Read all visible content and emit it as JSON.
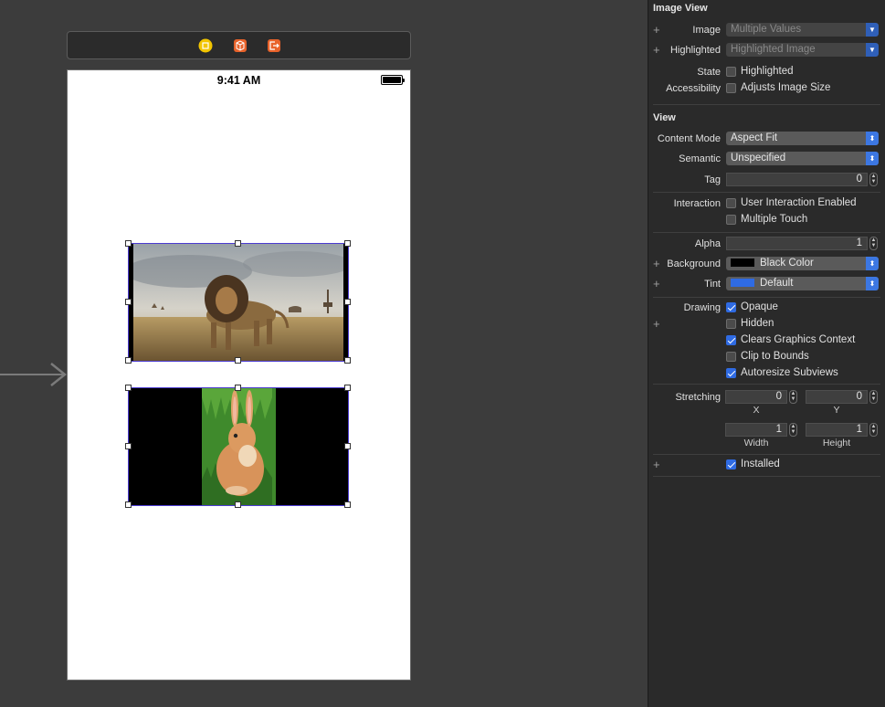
{
  "canvas": {
    "status_time": "9:41 AM"
  },
  "inspector": {
    "image_view": {
      "title": "Image View",
      "image_label": "Image",
      "image_value": "Multiple Values",
      "highlighted_label": "Highlighted",
      "highlighted_value": "Highlighted Image",
      "state_label": "State",
      "state_checkbox": "Highlighted",
      "accessibility_label": "Accessibility",
      "accessibility_checkbox": "Adjusts Image Size"
    },
    "view": {
      "title": "View",
      "content_mode_label": "Content Mode",
      "content_mode_value": "Aspect Fit",
      "semantic_label": "Semantic",
      "semantic_value": "Unspecified",
      "tag_label": "Tag",
      "tag_value": "0",
      "interaction_label": "Interaction",
      "user_interaction": "User Interaction Enabled",
      "multiple_touch": "Multiple Touch",
      "alpha_label": "Alpha",
      "alpha_value": "1",
      "background_label": "Background",
      "background_value": "Black Color",
      "background_color": "#000000",
      "tint_label": "Tint",
      "tint_value": "Default",
      "tint_color": "#2f6be3",
      "drawing_label": "Drawing",
      "opaque": "Opaque",
      "hidden": "Hidden",
      "clears_graphics": "Clears Graphics Context",
      "clip_to_bounds": "Clip to Bounds",
      "autoresize": "Autoresize Subviews",
      "stretching_label": "Stretching",
      "stretch_x": "0",
      "stretch_y": "0",
      "stretch_x_label": "X",
      "stretch_y_label": "Y",
      "stretch_width": "1",
      "stretch_height": "1",
      "stretch_width_label": "Width",
      "stretch_height_label": "Height",
      "installed": "Installed"
    }
  }
}
